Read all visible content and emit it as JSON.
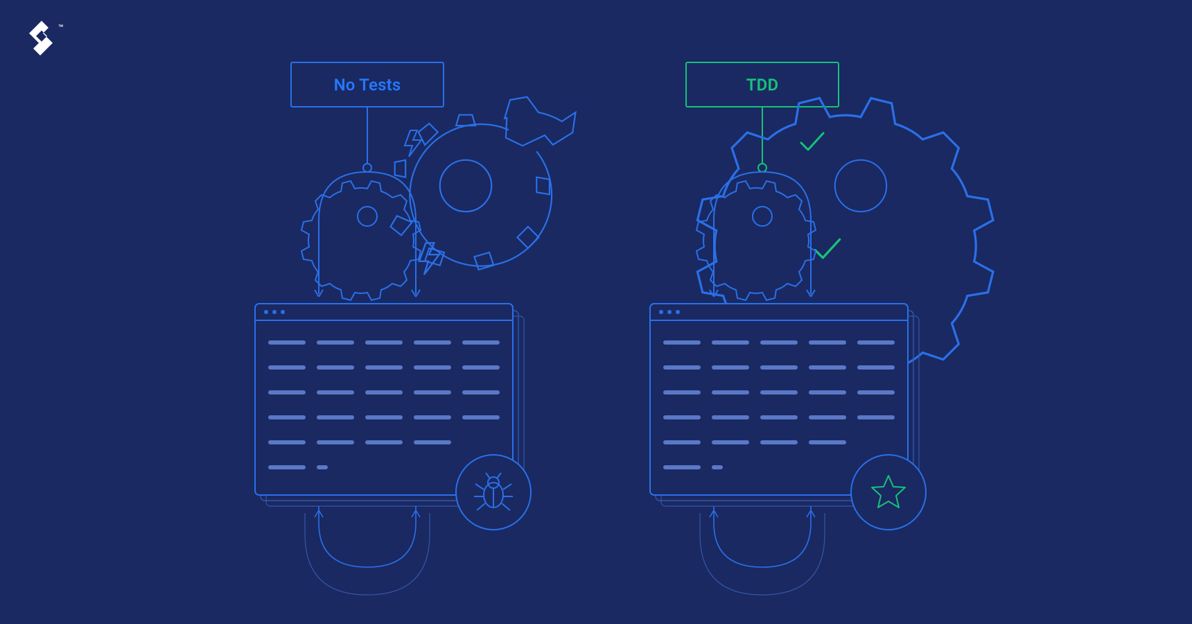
{
  "brand": {
    "trademark": "™"
  },
  "left": {
    "label": "No Tests",
    "label_color": "#2478ff",
    "box_stroke": "#2a70e8",
    "accent": "#3a7bf0",
    "gear_stroke": "#2a70e8",
    "zap_stroke": "#2a70e8",
    "badge_icon": "bug",
    "badge_color": "#2a70e8"
  },
  "right": {
    "label": "TDD",
    "label_color": "#17c27a",
    "box_stroke": "#17c27a",
    "accent": "#2a70e8",
    "gear_stroke": "#2a70e8",
    "tick_stroke": "#17c27a",
    "badge_icon": "star",
    "badge_color": "#17c27a"
  },
  "colors": {
    "bg": "#1a2962",
    "line_blue": "#2a70e8",
    "line_blue_muted": "#3556a8",
    "dashed_fill": "#5b78c7",
    "code_stroke": "#2a70e8",
    "logo": "#ffffff"
  }
}
